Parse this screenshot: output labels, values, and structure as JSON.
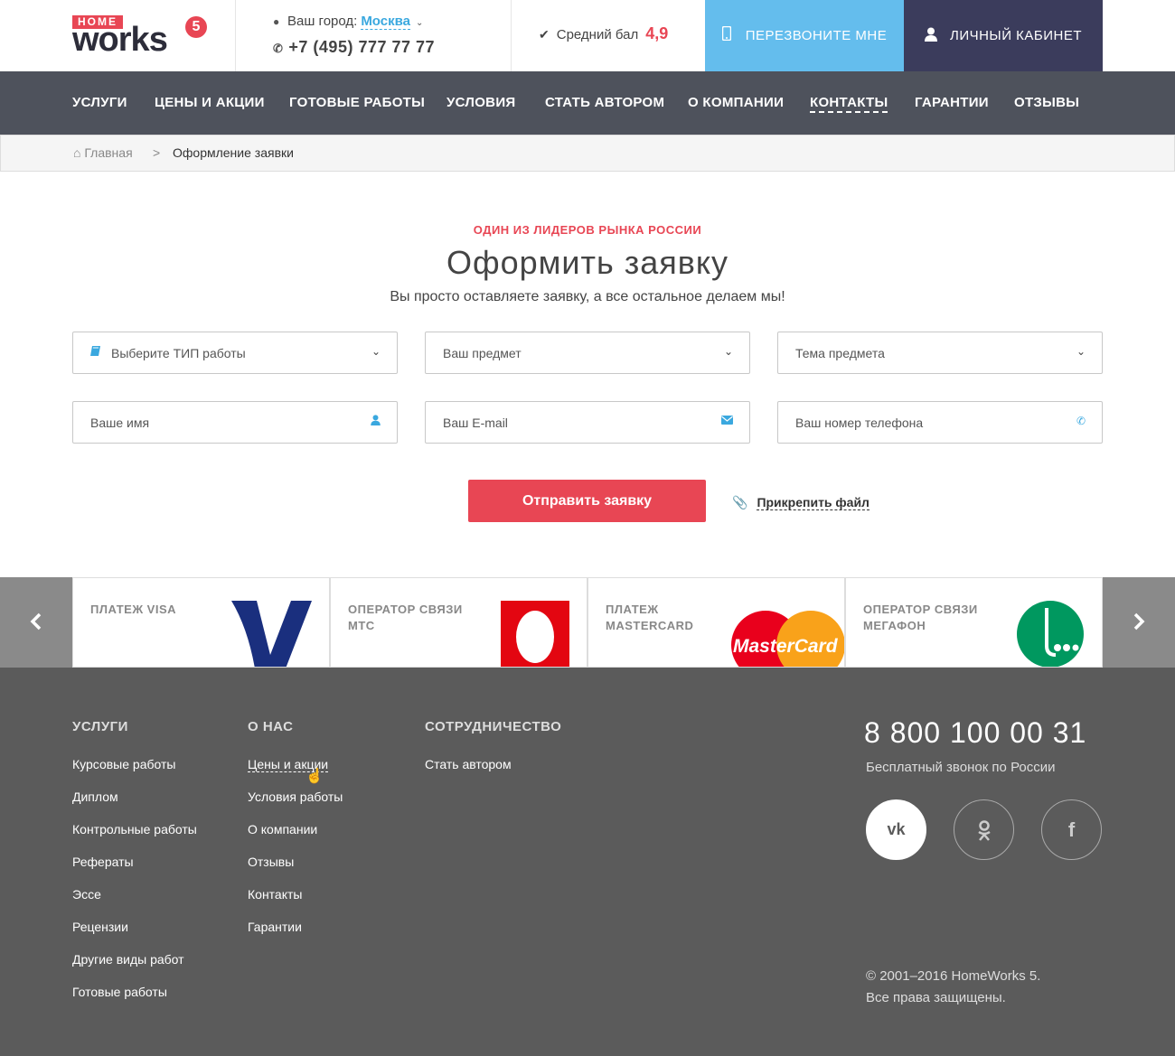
{
  "header": {
    "logo_badge": "HOME",
    "logo_text": "works",
    "logo_number": "5",
    "city_label": "Ваш город:",
    "city_value": "Москва",
    "phone": "+7 (495) 777 77 77",
    "rating_label": "Средний бал",
    "rating_value": "4,9",
    "callback_label": "ПЕРЕЗВОНИТЕ МНЕ",
    "cabinet_label": "ЛИЧНЫЙ КАБИНЕТ"
  },
  "nav": {
    "items": [
      {
        "label": "УСЛУГИ"
      },
      {
        "label": "ЦЕНЫ И АКЦИИ"
      },
      {
        "label": "ГОТОВЫЕ РАБОТЫ"
      },
      {
        "label": "УСЛОВИЯ"
      },
      {
        "label": "СТАТЬ АВТОРОМ"
      },
      {
        "label": "О КОМПАНИИ"
      },
      {
        "label": "КОНТАКТЫ"
      },
      {
        "label": "ГАРАНТИИ"
      },
      {
        "label": "ОТЗЫВЫ"
      }
    ],
    "active": "КОНТАКТЫ"
  },
  "breadcrumb": {
    "home": "Главная",
    "separator": ">",
    "current": "Оформление заявки"
  },
  "hero": {
    "eyebrow": "ОДИН ИЗ ЛИДЕРОВ РЫНКА РОССИИ",
    "title": "Оформить заявку",
    "subtitle": "Вы просто оставляете заявку, а все остальное делаем мы!"
  },
  "form": {
    "work_type_placeholder": "Выберите ТИП работы",
    "subject_placeholder": "Ваш предмет",
    "topic_placeholder": "Тема предмета",
    "name_placeholder": "Ваше имя",
    "email_placeholder": "Ваш E-mail",
    "phone_placeholder": "Ваш номер телефона",
    "submit_label": "Отправить заявку",
    "attach_label": "Прикрепить файл"
  },
  "payments": [
    {
      "label_line1": "ПЛАТЕЖ VISA",
      "label_line2": "",
      "logo": "visa-logo"
    },
    {
      "label_line1": "ОПЕРАТОР СВЯЗИ",
      "label_line2": "МТС",
      "logo": "mts-logo"
    },
    {
      "label_line1": "ПЛАТЕЖ",
      "label_line2": "MASTERCARD",
      "logo": "mastercard-logo",
      "logo_text": "MasterCard"
    },
    {
      "label_line1": "ОПЕРАТОР СВЯЗИ",
      "label_line2": "МЕГАФОН",
      "logo": "megafon-logo"
    }
  ],
  "footer": {
    "col1_title": "УСЛУГИ",
    "col1_links": [
      "Курсовые работы",
      "Диплом",
      "Контрольные работы",
      "Рефераты",
      "Эссе",
      "Рецензии",
      "Другие виды работ",
      "Готовые работы"
    ],
    "col2_title": "О НАС",
    "col2_links": [
      "Цены и акции",
      "Условия работы",
      "О компании",
      "Отзывы",
      "Контакты",
      "Гарантии"
    ],
    "col3_title": "СОТРУДНИЧЕСТВО",
    "col3_links": [
      "Стать автором"
    ],
    "phone": "8 800 100 00 31",
    "phone_note": "Бесплатный звонок по России",
    "social": [
      "vk-icon",
      "odnoklassniki-icon",
      "facebook-icon"
    ],
    "copyright_line1": "© 2001–2016 HomeWorks 5.",
    "copyright_line2": "Все права защищены."
  },
  "colors": {
    "accent_red": "#e84654",
    "accent_blue": "#64bded",
    "nav_bg": "#4e525c",
    "footer_bg": "#5b5b5b",
    "cabinet_bg": "#3b3c5c"
  }
}
